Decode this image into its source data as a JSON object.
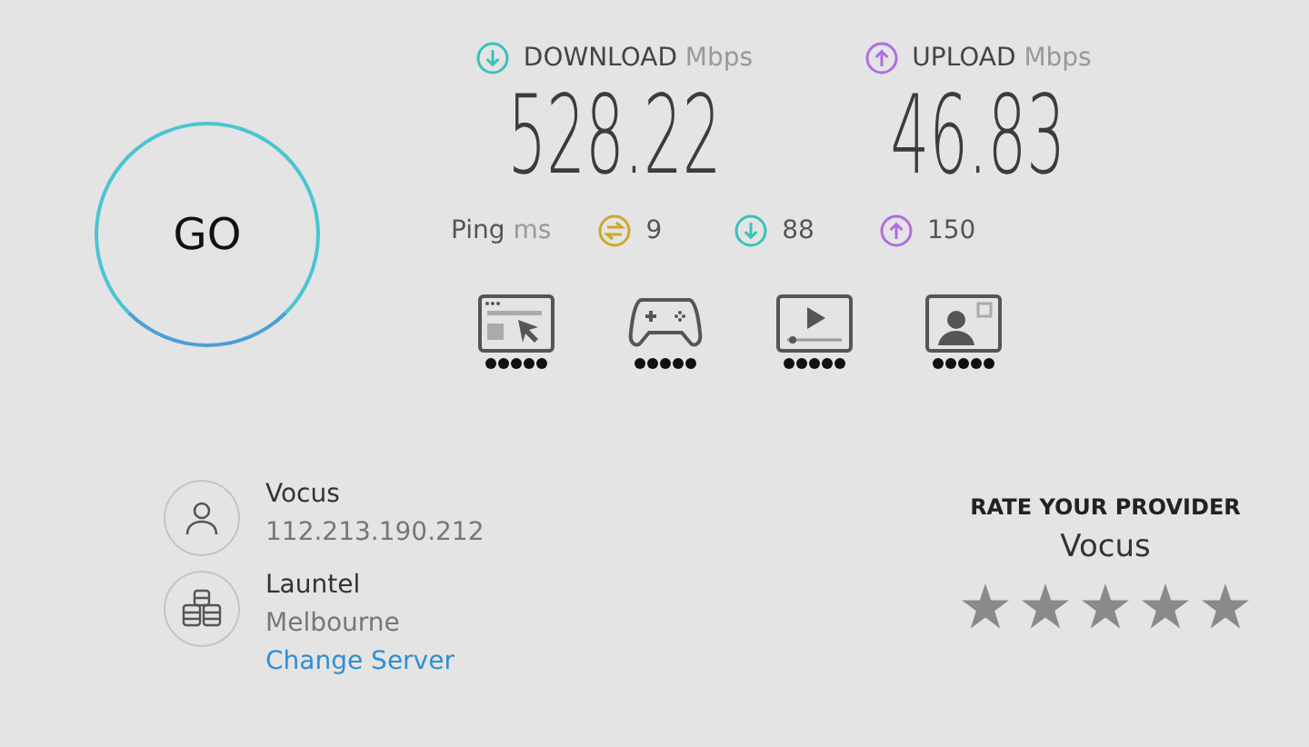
{
  "go_button": {
    "label": "GO"
  },
  "speeds": [
    {
      "kind": "download",
      "label": "DOWNLOAD",
      "unit": "Mbps",
      "value": "528.22"
    },
    {
      "kind": "upload",
      "label": "UPLOAD",
      "unit": "Mbps",
      "value": "46.83"
    }
  ],
  "ping": {
    "label": "Ping",
    "unit": "ms",
    "items": [
      {
        "kind": "ping",
        "value": "9"
      },
      {
        "kind": "download",
        "value": "88"
      },
      {
        "kind": "upload",
        "value": "150"
      }
    ]
  },
  "activities": [
    {
      "kind": "browsing",
      "stars": 5
    },
    {
      "kind": "gaming",
      "stars": 5
    },
    {
      "kind": "streaming",
      "stars": 5
    },
    {
      "kind": "video_call",
      "stars": 5
    }
  ],
  "provider": {
    "name": "Vocus",
    "ip": "112.213.190.212"
  },
  "server": {
    "name": "Launtel",
    "location": "Melbourne",
    "link": "Change Server"
  },
  "rating": {
    "title": "RATE YOUR PROVIDER",
    "provider": "Vocus"
  }
}
